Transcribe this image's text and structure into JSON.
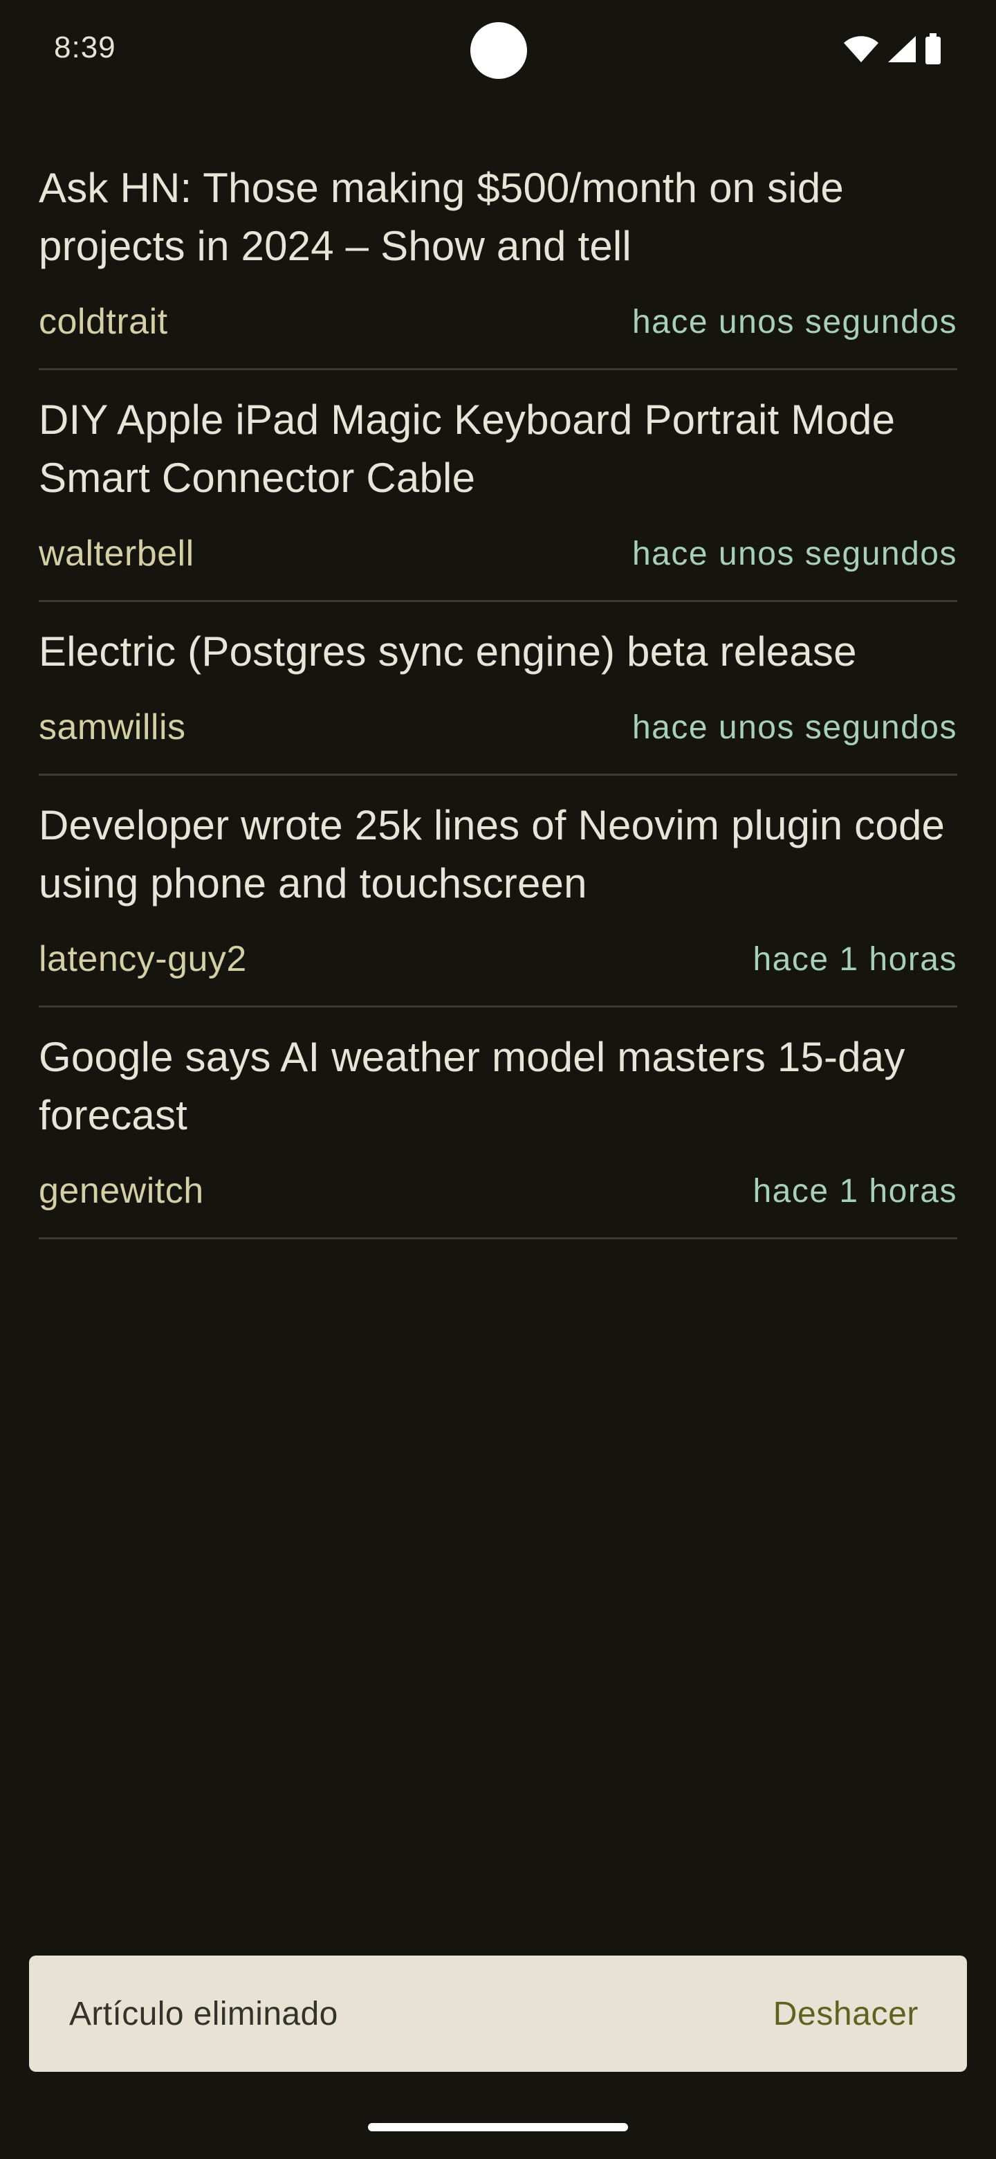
{
  "status_bar": {
    "time": "8:39",
    "icons": [
      "wifi-icon",
      "cellular-signal-icon",
      "battery-icon"
    ]
  },
  "feed": {
    "items": [
      {
        "title": "Ask HN: Those making $500/month on side projects in 2024 – Show and tell",
        "author": "coldtrait",
        "time": "hace unos segundos"
      },
      {
        "title": "DIY Apple iPad Magic Keyboard Portrait Mode Smart Connector Cable",
        "author": "walterbell",
        "time": "hace unos segundos"
      },
      {
        "title": "Electric (Postgres sync engine) beta release",
        "author": "samwillis",
        "time": "hace unos segundos"
      },
      {
        "title": "Developer wrote 25k lines of Neovim plugin code using phone and touchscreen",
        "author": "latency-guy2",
        "time": "hace 1 horas"
      },
      {
        "title": "Google says AI weather model masters 15-day forecast",
        "author": "genewitch",
        "time": "hace 1 horas"
      }
    ]
  },
  "snackbar": {
    "message": "Artículo eliminado",
    "action": "Deshacer"
  },
  "colors": {
    "background": "#15140e",
    "title_text": "#e8e4d8",
    "author_text": "#d4cfa4",
    "time_text": "#a8cfbe",
    "divider": "#3b3a33",
    "snackbar_bg": "#e7e2d4",
    "snackbar_action": "#5e6220"
  }
}
